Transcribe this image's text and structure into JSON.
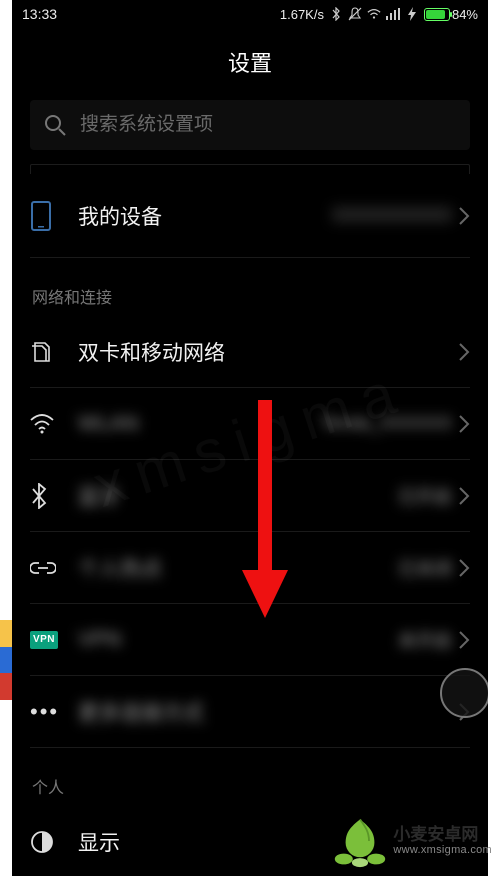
{
  "status": {
    "time": "13:33",
    "net_speed": "1.67K/s",
    "battery_pct": "84%"
  },
  "header": {
    "title": "设置"
  },
  "search": {
    "placeholder": "搜索系统设置项"
  },
  "sections": {
    "my_device": {
      "label": "我的设备",
      "value": "XXXXXXXXXX"
    },
    "net_title": "网络和连接",
    "dual_sim": {
      "label": "双卡和移动网络"
    },
    "wlan": {
      "label": "WLAN",
      "value": "Tenda_XXXXXX"
    },
    "bluetooth": {
      "label": "蓝牙",
      "value": "已开启"
    },
    "hotspot": {
      "label": "个人热点",
      "value": "已关闭"
    },
    "vpn": {
      "label": "VPN",
      "value": "未开启",
      "badge": "VPN"
    },
    "more": {
      "label": "更多连接方式"
    },
    "personal_title": "个人",
    "display": {
      "label": "显示"
    }
  },
  "watermark": {
    "name": "小麦安卓网",
    "url": "www.xmsigma.com"
  }
}
